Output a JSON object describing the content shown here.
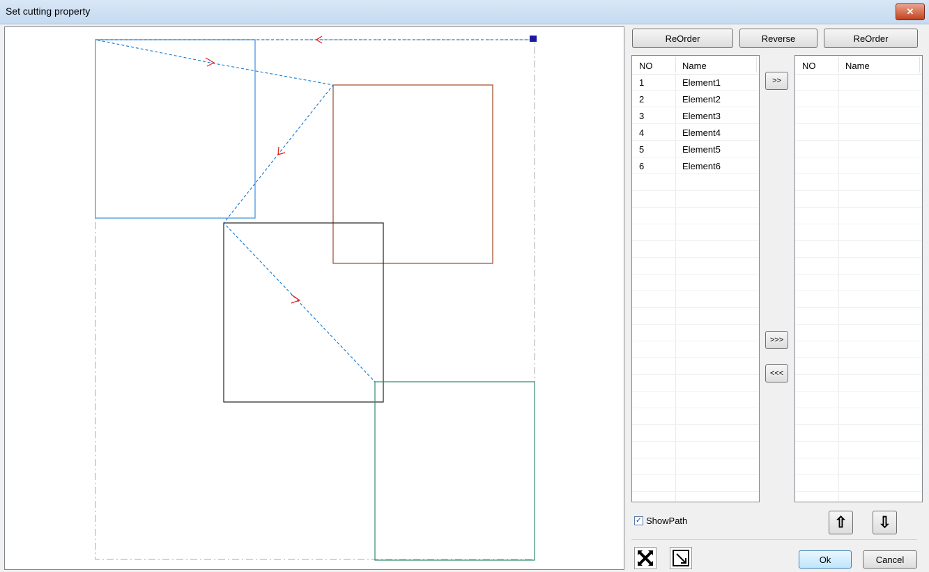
{
  "window": {
    "title": "Set cutting property",
    "close_glyph": "✕"
  },
  "toolbar": {
    "reorder_left": "ReOrder",
    "reverse": "Reverse",
    "reorder_right": "ReOrder"
  },
  "left_list": {
    "headers": {
      "no": "NO",
      "name": "Name"
    },
    "rows": [
      {
        "no": "1",
        "name": "Element1"
      },
      {
        "no": "2",
        "name": "Element2"
      },
      {
        "no": "3",
        "name": "Element3"
      },
      {
        "no": "4",
        "name": "Element4"
      },
      {
        "no": "5",
        "name": "Element5"
      },
      {
        "no": "6",
        "name": "Element6"
      }
    ]
  },
  "right_list": {
    "headers": {
      "no": "NO",
      "name": "Name"
    },
    "rows": []
  },
  "transfer": {
    "move_one": ">>",
    "move_all": ">>>",
    "move_back_all": "<<<"
  },
  "order": {
    "up_glyph": "⇧",
    "down_glyph": "⇩"
  },
  "options": {
    "show_path_label": "ShowPath",
    "show_path_checked": true,
    "check_glyph": "✓"
  },
  "footer": {
    "ok": "Ok",
    "cancel": "Cancel"
  },
  "icons": [
    "close-icon",
    "fit-view-icon",
    "select-region-icon",
    "move-up-icon",
    "move-down-icon",
    "checkbox-checked-icon"
  ],
  "colors": {
    "path": "#1e7fd6",
    "path_arrow": "#e02020",
    "element_blue": "#3a8ee0",
    "element_brown": "#9c4a24",
    "element_black": "#222222",
    "element_green": "#2e8b67",
    "boundary": "#aaaaaa",
    "start_marker": "#1a1aa0"
  }
}
